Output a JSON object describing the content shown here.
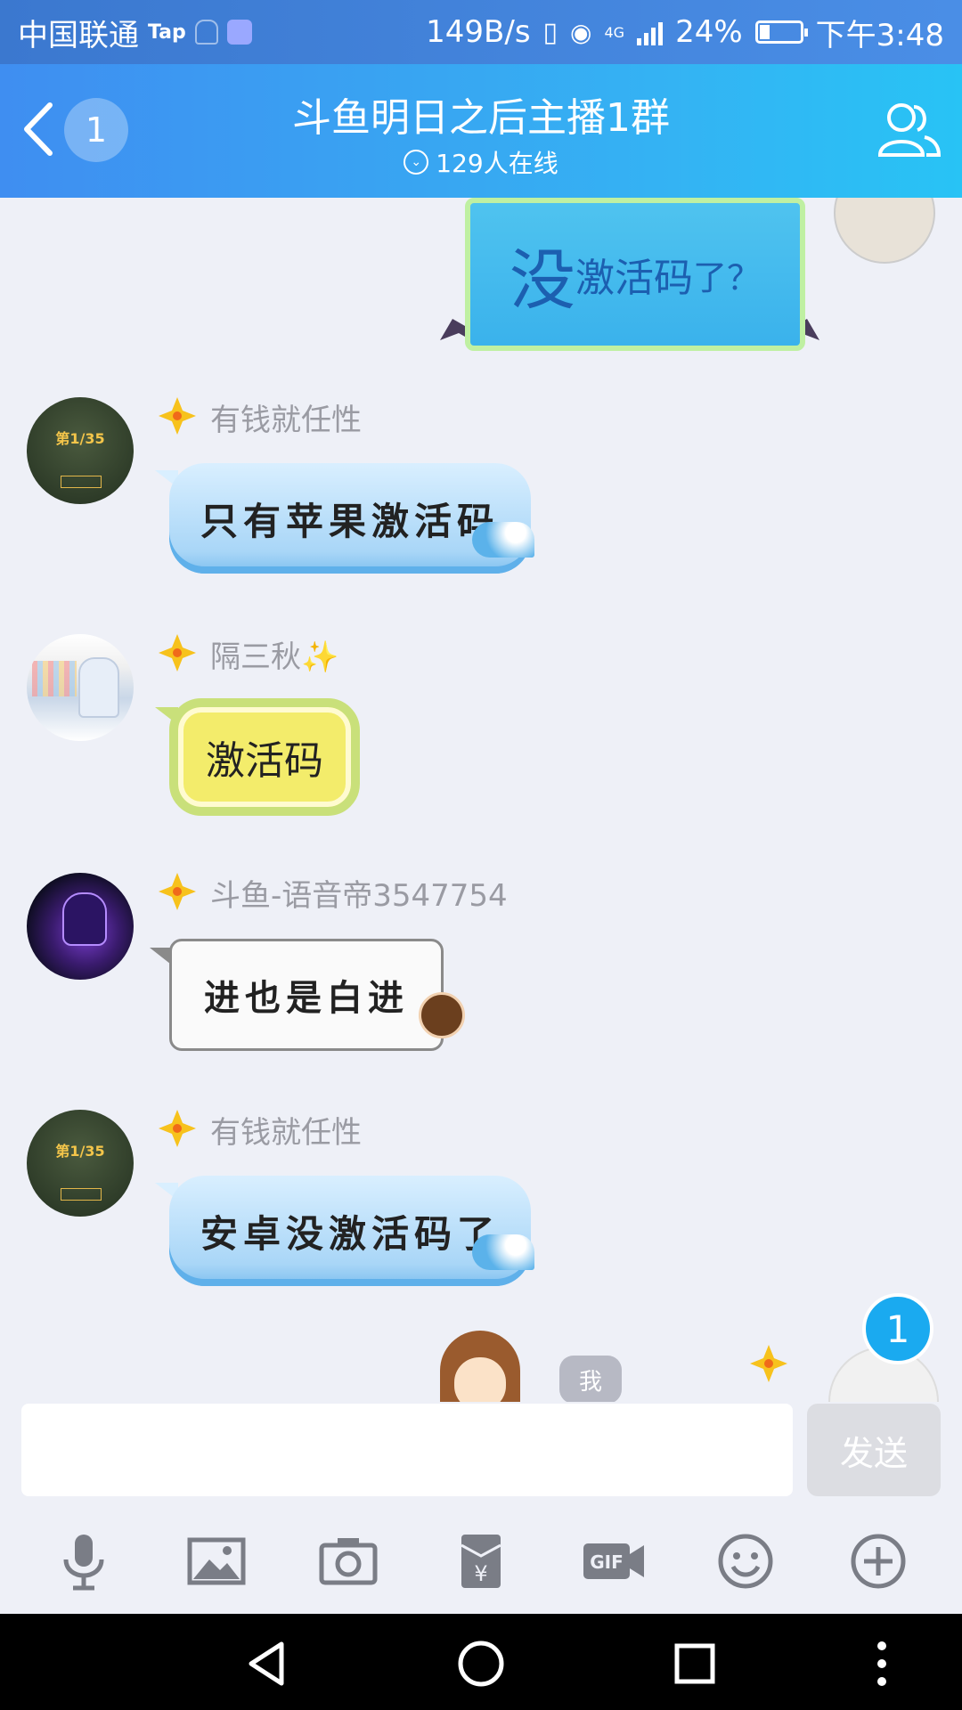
{
  "status_bar": {
    "carrier": "中国联通",
    "tap": "Tap",
    "net_speed": "149B/s",
    "network": "4G",
    "battery": "24%",
    "time": "下午3:48"
  },
  "header": {
    "back_badge": "1",
    "title": "斗鱼明日之后主播1群",
    "online": "129人在线"
  },
  "messages": [
    {
      "nick": "有钱就任性",
      "text": "只有苹果激活码"
    },
    {
      "nick": "隔三秋✨",
      "text": "激活码"
    },
    {
      "nick": "斗鱼-语音帝3547754",
      "text": "进也是白进"
    },
    {
      "nick": "有钱就任性",
      "text": "安卓没激活码了"
    }
  ],
  "own_message": {
    "text_big": "没",
    "text_mid": "激活码",
    "text_small": "了？"
  },
  "bottom_tag": "我",
  "unread_float": "1",
  "composer": {
    "send_label": "发送",
    "input_value": ""
  },
  "toolbar_icons": [
    "microphone-icon",
    "image-icon",
    "camera-icon",
    "red-packet-icon",
    "gif-icon",
    "emoji-icon",
    "plus-icon"
  ]
}
